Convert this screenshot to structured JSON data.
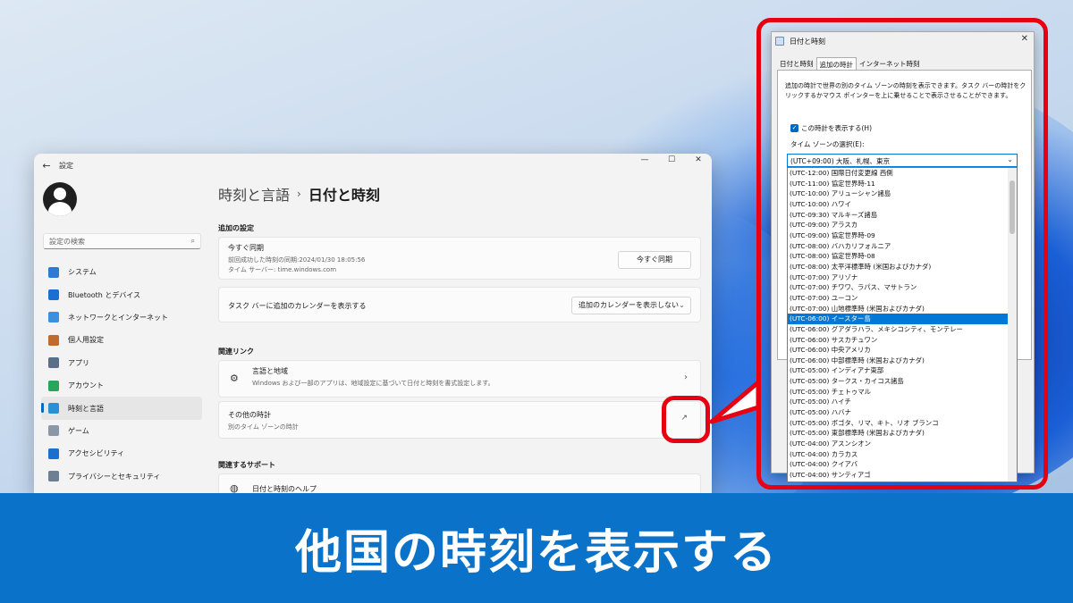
{
  "settings": {
    "window_title": "設定",
    "search_placeholder": "設定の検索",
    "nav": [
      {
        "label": "システム",
        "icon": "monitor-icon",
        "color": "#2b7bd3"
      },
      {
        "label": "Bluetooth とデバイス",
        "icon": "bluetooth-icon",
        "color": "#1a6fd0"
      },
      {
        "label": "ネットワークとインターネット",
        "icon": "wifi-icon",
        "color": "#3a8fe0"
      },
      {
        "label": "個人用設定",
        "icon": "brush-icon",
        "color": "#c06a2b"
      },
      {
        "label": "アプリ",
        "icon": "apps-icon",
        "color": "#5a6f88"
      },
      {
        "label": "アカウント",
        "icon": "person-icon",
        "color": "#2aa55c"
      },
      {
        "label": "時刻と言語",
        "icon": "globe-clock-icon",
        "color": "#2b8fd8",
        "selected": true
      },
      {
        "label": "ゲーム",
        "icon": "gamepad-icon",
        "color": "#8a97a8"
      },
      {
        "label": "アクセシビリティ",
        "icon": "accessibility-icon",
        "color": "#1a6fd0"
      },
      {
        "label": "プライバシーとセキュリティ",
        "icon": "shield-icon",
        "color": "#6f7f92"
      }
    ],
    "breadcrumb": {
      "parent": "時刻と言語",
      "separator": "›",
      "current": "日付と時刻"
    },
    "additional_settings": {
      "heading": "追加の設定",
      "sync": {
        "title": "今すぐ同期",
        "last_sync": "前回成功した時刻の同期:2024/01/30 18:05:56",
        "server": "タイム サーバー: time.windows.com",
        "button": "今すぐ同期"
      },
      "calendar": {
        "label": "タスク バーに追加のカレンダーを表示する",
        "value": "追加のカレンダーを表示しない"
      }
    },
    "related_links": {
      "heading": "関連リンク",
      "region": {
        "title": "言語と地域",
        "desc": "Windows および一部のアプリは、地域設定に基づいて日付と時刻を書式設定します。"
      },
      "other_clocks": {
        "title": "その他の時計",
        "desc": "別のタイム ゾーンの時計"
      }
    },
    "support": {
      "heading": "関連するサポート",
      "item": "日付と時刻のヘルプ"
    }
  },
  "dialog": {
    "title": "日付と時刻",
    "tabs": [
      "日付と時刻",
      "追加の時計",
      "インターネット時刻"
    ],
    "active_tab": "追加の時計",
    "description": "追加の時計で世界の別のタイム ゾーンの時刻を表示できます。タスク バーの時計をクリックするかマウス ポインターを上に乗せることで表示させることができます。",
    "show_clock_label": "この時計を表示する(H)",
    "timezone_label": "タイム ゾーンの選択(E):",
    "timezone_value": "(UTC+09:00) 大阪、札幌、東京",
    "timezone_options": [
      "(UTC-12:00) 国際日付変更線 西側",
      "(UTC-11:00) 協定世界時-11",
      "(UTC-10:00) アリューシャン諸島",
      "(UTC-10:00) ハワイ",
      "(UTC-09:30) マルキーズ諸島",
      "(UTC-09:00) アラスカ",
      "(UTC-09:00) 協定世界時-09",
      "(UTC-08:00) バハカリフォルニア",
      "(UTC-08:00) 協定世界時-08",
      "(UTC-08:00) 太平洋標準時 (米国およびカナダ)",
      "(UTC-07:00) アリゾナ",
      "(UTC-07:00) チワワ、ラパス、マサトラン",
      "(UTC-07:00) ユーコン",
      "(UTC-07:00) 山地標準時 (米国およびカナダ)",
      "(UTC-06:00) イースター島",
      "(UTC-06:00) グアダラハラ、メキシコシティ、モンテレー",
      "(UTC-06:00) サスカチュワン",
      "(UTC-06:00) 中央アメリカ",
      "(UTC-06:00) 中部標準時 (米国およびカナダ)",
      "(UTC-05:00) インディアナ東部",
      "(UTC-05:00) タークス・カイコス諸島",
      "(UTC-05:00) チェトゥマル",
      "(UTC-05:00) ハイチ",
      "(UTC-05:00) ハバナ",
      "(UTC-05:00) ボゴタ、リマ、キト、リオ ブランコ",
      "(UTC-05:00) 東部標準時 (米国およびカナダ)",
      "(UTC-04:00) アスンシオン",
      "(UTC-04:00) カラカス",
      "(UTC-04:00) クイアバ",
      "(UTC-04:00) サンティアゴ"
    ],
    "highlighted_option": "(UTC-06:00) イースター島"
  },
  "banner": "他国の時刻を表示する",
  "colors": {
    "accent": "#0067c0",
    "callout": "#e60012",
    "banner": "#0a73c9"
  }
}
